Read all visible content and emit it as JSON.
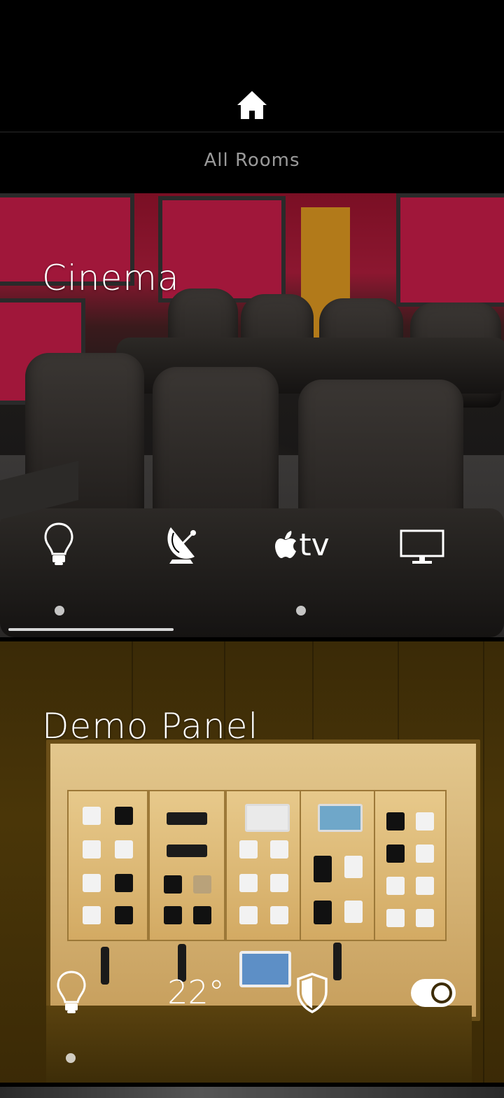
{
  "header": {
    "home_icon": "home-icon",
    "title": "All Rooms"
  },
  "rooms": [
    {
      "name": "Cinema",
      "controls": [
        {
          "icon": "lightbulb-icon"
        },
        {
          "icon": "satellite-dish-icon"
        },
        {
          "icon": "apple-tv-icon",
          "label": "tv"
        },
        {
          "icon": "monitor-icon"
        }
      ],
      "page_indicators": 2
    },
    {
      "name": "Demo Panel",
      "controls": [
        {
          "icon": "lightbulb-icon"
        },
        {
          "icon": "temperature-readout",
          "label": "22°"
        },
        {
          "icon": "shield-icon"
        },
        {
          "icon": "toggle-switch-icon",
          "state": "on"
        }
      ],
      "page_indicators": 1
    }
  ],
  "colors": {
    "background": "#000000",
    "header_text": "#9a9a9a",
    "foreground": "#ffffff"
  }
}
